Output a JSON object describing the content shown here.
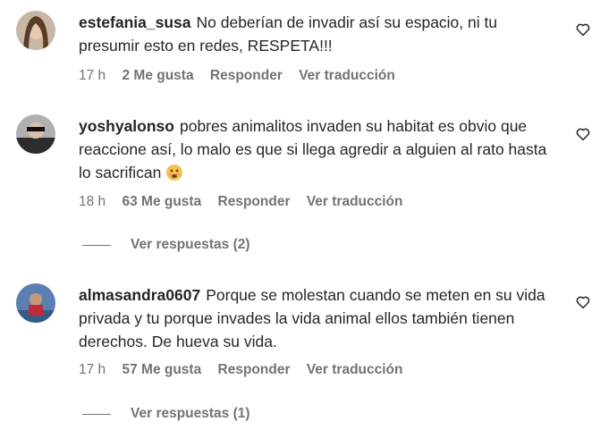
{
  "comments": [
    {
      "username": "estefania_susa",
      "text": "No deberían de invadir así su espacio, ni tu presumir esto en redes, RESPETA!!!",
      "time": "17 h",
      "likes": "2 Me gusta",
      "reply": "Responder",
      "translate": "Ver traducción"
    },
    {
      "username": "yoshyalonso",
      "text": "pobres animalitos invaden su habitat es obvio que reaccione así, lo malo es que si llega agredir a alguien al rato hasta lo sacrifican",
      "time": "18 h",
      "likes": "63 Me gusta",
      "reply": "Responder",
      "translate": "Ver traducción",
      "view_replies": "Ver respuestas (2)"
    },
    {
      "username": "almasandra0607",
      "text": "Porque se molestan cuando se meten en su vida privada y tu porque invades la vida animal ellos también tienen derechos. De hueva su vida.",
      "time": "17 h",
      "likes": "57 Me gusta",
      "reply": "Responder",
      "translate": "Ver traducción",
      "view_replies": "Ver respuestas (1)"
    }
  ],
  "icons": {
    "like": "heart-outline-icon",
    "emoji": "sad-face-emoji"
  }
}
